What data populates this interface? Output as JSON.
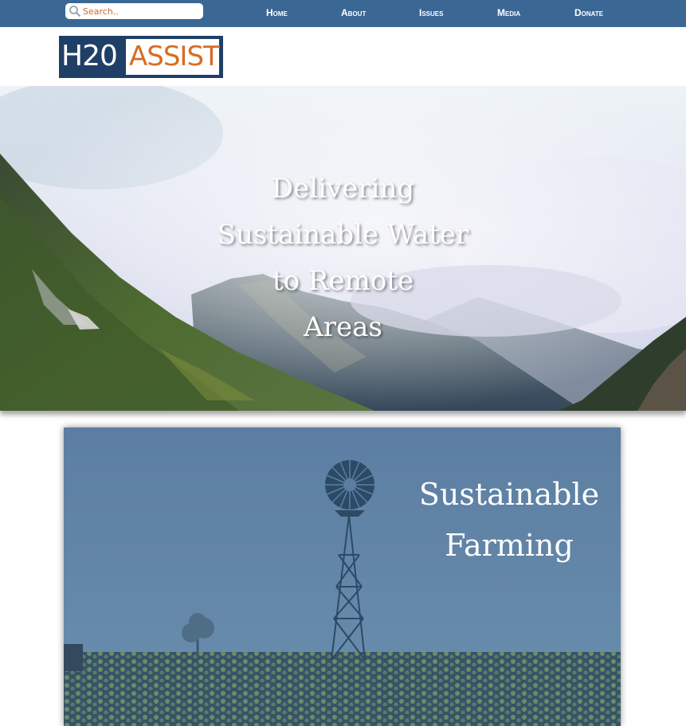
{
  "search": {
    "placeholder": "Search.."
  },
  "nav": [
    {
      "label": "Home"
    },
    {
      "label": "About"
    },
    {
      "label": "Issues"
    },
    {
      "label": "Media"
    },
    {
      "label": "Donate"
    }
  ],
  "logo": {
    "part1": "H20",
    "part2": "ASSIST"
  },
  "hero": {
    "lines": [
      "Delivering",
      "Sustainable Water",
      "to Remote",
      "Areas"
    ]
  },
  "feature": {
    "lines": [
      "Sustainable",
      "Farming"
    ]
  },
  "colors": {
    "nav_bg": "#3b6794",
    "brand_dark": "#1f3f66",
    "brand_orange": "#d86c24"
  },
  "icons": {
    "search": "search-icon",
    "windmill": "windmill-icon"
  }
}
